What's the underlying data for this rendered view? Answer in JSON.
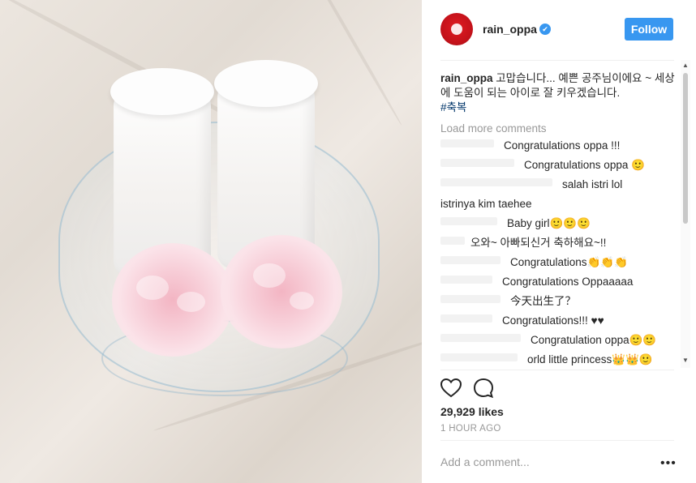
{
  "post": {
    "username": "rain_oppa",
    "verified_icon": "✔",
    "follow_label": "Follow",
    "caption_user": "rain_oppa",
    "caption_text": " 고맙습니다... 예쁜 공주님이에요 ~ 세상에 도움이 되는 아이로 잘 키우겠습니다.",
    "hashtag": "#축복",
    "load_more": "Load more comments"
  },
  "comments": [
    {
      "text": "Congratulations oppa !!!",
      "indent": 78
    },
    {
      "text": "Congratulations oppa 🙂",
      "indent": 103
    },
    {
      "text": "salah istri lol",
      "indent": 150
    },
    {
      "text": "istrinya kim taehee",
      "indent": 0
    },
    {
      "text": "Baby girl🙂🙂🙂",
      "indent": 82
    },
    {
      "text": "오와~ 아빠되신거 축하해요~!!",
      "indent": 37
    },
    {
      "text": "Congratulations👏👏👏",
      "indent": 86
    },
    {
      "text": "Congratulations Oppaaaaa",
      "indent": 76
    },
    {
      "text": "今天出生了？",
      "indent": 86
    },
    {
      "text": "Congratulations!!! ♥♥",
      "indent": 76
    },
    {
      "text": "Congratulation oppa🙂🙂",
      "indent": 111
    },
    {
      "text": "orld little princess👑👑🙂",
      "indent": 107
    }
  ],
  "actions": {
    "like_icon": "heart-icon",
    "comment_icon": "comment-icon"
  },
  "likes": "29,929 likes",
  "time": "1 HOUR AGO",
  "add_comment_placeholder": "Add a comment...",
  "more_icon": "•••",
  "colors": {
    "accent": "#3897f0",
    "hashtag": "#003569",
    "muted": "#999999",
    "avatar": "#c3121a"
  }
}
